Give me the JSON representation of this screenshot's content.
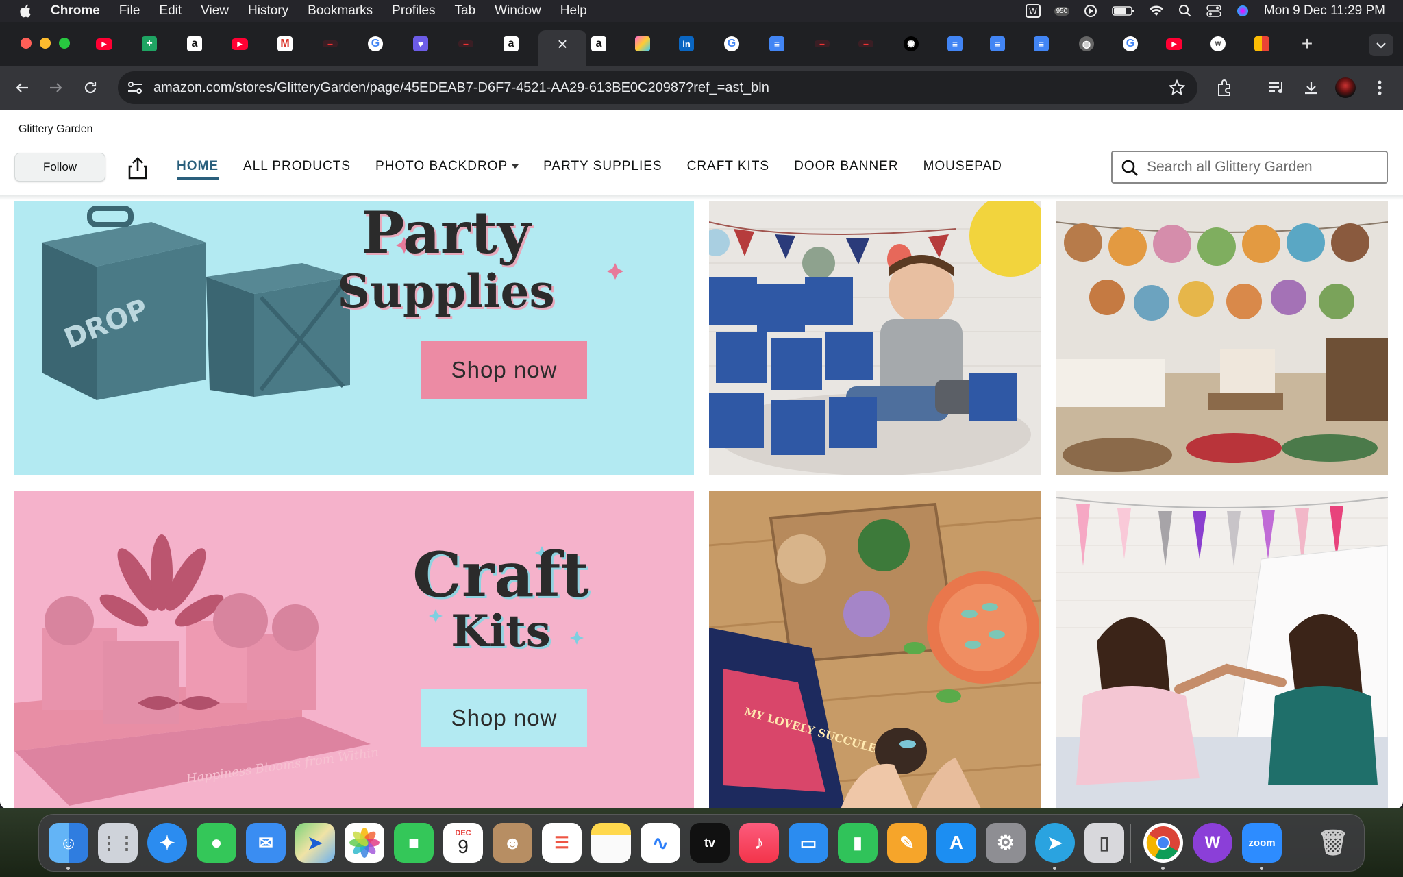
{
  "menubar": {
    "app_name": "Chrome",
    "menus": [
      "File",
      "Edit",
      "View",
      "History",
      "Bookmarks",
      "Profiles",
      "Tab",
      "Window",
      "Help"
    ],
    "badge": "950",
    "datetime": "Mon 9 Dec  11:29 PM"
  },
  "browser": {
    "url": "amazon.com/stores/GlitteryGarden/page/45EDEAB7-D6F7-4521-AA29-613BE0C20987?ref_=ast_bln",
    "active_tab_close": "×",
    "new_tab": "+"
  },
  "store": {
    "name": "Glittery Garden",
    "follow_label": "Follow",
    "nav": [
      "HOME",
      "ALL PRODUCTS",
      "PHOTO BACKDROP",
      "PARTY SUPPLIES",
      "CRAFT KITS",
      "DOOR BANNER",
      "MOUSEPAD"
    ],
    "search_placeholder": "Search all Glittery Garden"
  },
  "banners": {
    "party": {
      "title_line1": "Party",
      "title_line2": "Supplies",
      "cta": "Shop now",
      "crate_text": "DROP"
    },
    "craft": {
      "title_line1": "Craft",
      "title_line2": "Kits",
      "cta": "Shop now",
      "tray_text": "Happiness Blooms from Within"
    },
    "kit_box_text": "MY LOVELY SUCCULENTS"
  },
  "colors": {
    "party_bg": "#b3eaf2",
    "party_btn": "#ec8ba4",
    "craft_bg": "#f5b2cb",
    "craft_btn": "#b3eaf2",
    "nav_active": "#2a5f7c"
  },
  "dock": {
    "calendar_month": "DEC",
    "calendar_day": "9",
    "tv_label": "tv",
    "zoom_label": "zoom"
  }
}
